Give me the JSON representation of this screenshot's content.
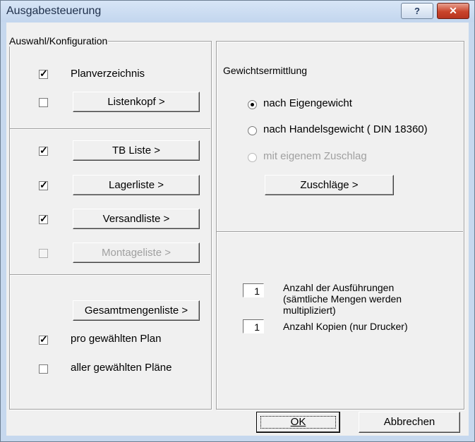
{
  "window": {
    "title": "Ausgabesteuerung",
    "help_label": "?",
    "close_label": "✕"
  },
  "left": {
    "legend": "Auswahl/Konfiguration",
    "planverzeichnis": {
      "label": "Planverzeichnis",
      "checked": true
    },
    "listenkopf": {
      "button_label": "Listenkopf >",
      "checked": false
    },
    "tb_liste": {
      "button_label": "TB Liste >",
      "checked": true
    },
    "lagerliste": {
      "button_label": "Lagerliste >",
      "checked": true
    },
    "versandliste": {
      "button_label": "Versandliste >",
      "checked": true
    },
    "montageliste": {
      "button_label": "Montageliste >",
      "checked": false,
      "disabled": true
    },
    "gesamtmengenliste": {
      "button_label": "Gesamtmengenliste >"
    },
    "pro_plan": {
      "label": "pro gewählten Plan",
      "checked": true
    },
    "aller_plaene": {
      "label": "aller gewählten Pläne",
      "checked": false
    }
  },
  "right": {
    "gewicht_title": "Gewichtsermittlung",
    "radio_eigengewicht": "nach Eigengewicht",
    "radio_handelsgewicht": "nach Handelsgewicht ( DIN 18360)",
    "radio_zuschlag": "mit eigenem Zuschlag",
    "selected_radio": "nach Eigengewicht",
    "zuschlaege_button": "Zuschläge >",
    "ausfuehrungen": {
      "value": "1",
      "label_line1": "Anzahl der Ausführungen",
      "label_line2": "(sämtliche Mengen werden",
      "label_line3": "multipliziert)"
    },
    "kopien": {
      "value": "1",
      "label": "Anzahl Kopien (nur Drucker)"
    }
  },
  "footer": {
    "ok_label": "OK",
    "cancel_label": "Abbrechen"
  },
  "check_mark": "✓"
}
